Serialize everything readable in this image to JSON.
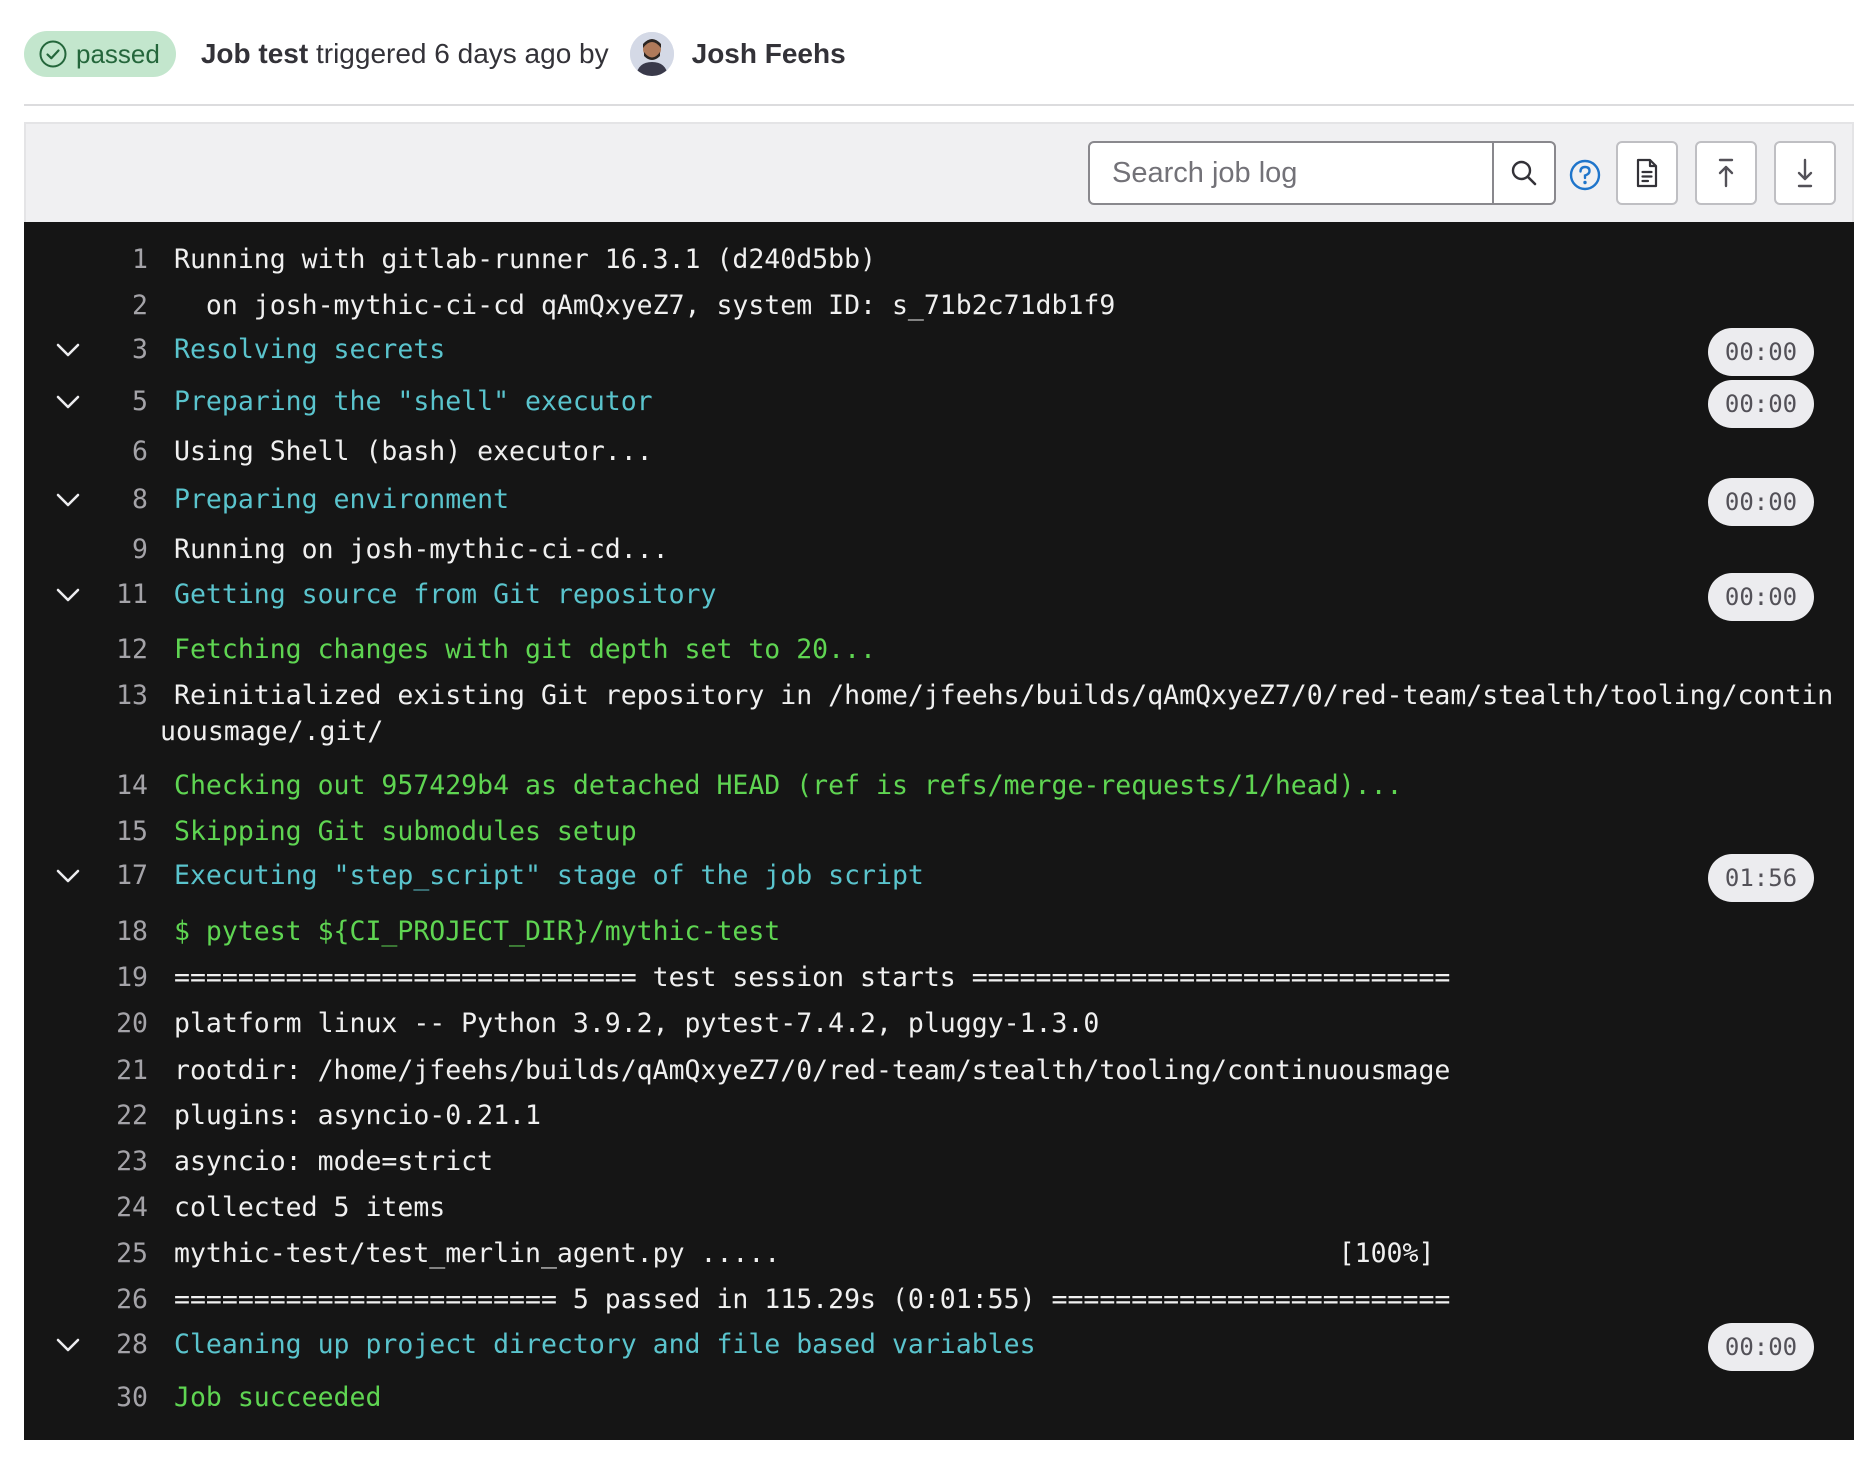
{
  "header": {
    "status": "passed",
    "job_prefix": "Job test",
    "job_suffix": " triggered 6 days ago by",
    "author": "Josh Feehs"
  },
  "toolbar": {
    "search_placeholder": "Search job log",
    "icons": [
      "search-icon",
      "help-icon",
      "raw-log-icon",
      "scroll-to-top-icon",
      "scroll-to-bottom-icon"
    ]
  },
  "log": {
    "lines": [
      {
        "n": "1",
        "text": "Running with gitlab-runner 16.3.1 (d240d5bb)",
        "style": "plain"
      },
      {
        "n": "2",
        "text": "  on josh-mythic-ci-cd qAmQxyeZ7, system ID: s_71b2c71db1f9",
        "style": "plain"
      },
      {
        "n": "3",
        "text": "Resolving secrets",
        "style": "cyan",
        "section": true,
        "duration": "00:00"
      },
      {
        "n": "5",
        "text": "Preparing the \"shell\" executor",
        "style": "cyan",
        "section": true,
        "duration": "00:00"
      },
      {
        "n": "6",
        "text": "Using Shell (bash) executor...",
        "style": "plain"
      },
      {
        "n": "8",
        "text": "Preparing environment",
        "style": "cyan",
        "section": true,
        "duration": "00:00"
      },
      {
        "n": "9",
        "text": "Running on josh-mythic-ci-cd...",
        "style": "plain"
      },
      {
        "n": "11",
        "text": "Getting source from Git repository",
        "style": "cyan",
        "section": true,
        "duration": "00:00"
      },
      {
        "n": "12",
        "text": "Fetching changes with git depth set to 20...",
        "style": "green"
      },
      {
        "n": "13",
        "text": "Reinitialized existing Git repository in /home/jfeehs/builds/qAmQxyeZ7/0/red-team/stealth/tooling/contin",
        "cont": "uousmage/.git/",
        "style": "plain"
      },
      {
        "n": "14",
        "text": "Checking out 957429b4 as detached HEAD (ref is refs/merge-requests/1/head)...",
        "style": "green"
      },
      {
        "n": "15",
        "text": "Skipping Git submodules setup",
        "style": "green"
      },
      {
        "n": "17",
        "text": "Executing \"step_script\" stage of the job script",
        "style": "cyan",
        "section": true,
        "duration": "01:56"
      },
      {
        "n": "18",
        "text": "$ pytest ${CI_PROJECT_DIR}/mythic-test",
        "style": "green"
      },
      {
        "n": "19",
        "text": "============================= test session starts ==============================",
        "style": "plain"
      },
      {
        "n": "20",
        "text": "platform linux -- Python 3.9.2, pytest-7.4.2, pluggy-1.3.0",
        "style": "plain"
      },
      {
        "n": "21",
        "text": "rootdir: /home/jfeehs/builds/qAmQxyeZ7/0/red-team/stealth/tooling/continuousmage",
        "style": "plain"
      },
      {
        "n": "22",
        "text": "plugins: asyncio-0.21.1",
        "style": "plain"
      },
      {
        "n": "23",
        "text": "asyncio: mode=strict",
        "style": "plain"
      },
      {
        "n": "24",
        "text": "collected 5 items",
        "style": "plain"
      },
      {
        "n": "25",
        "text": "mythic-test/test_merlin_agent.py .....                                   [100%]",
        "style": "plain"
      },
      {
        "n": "26",
        "text": "======================== 5 passed in 115.29s (0:01:55) =========================",
        "style": "plain"
      },
      {
        "n": "28",
        "text": "Cleaning up project directory and file based variables",
        "style": "cyan",
        "section": true,
        "duration": "00:00"
      },
      {
        "n": "30",
        "text": "Job succeeded",
        "style": "green"
      }
    ]
  }
}
